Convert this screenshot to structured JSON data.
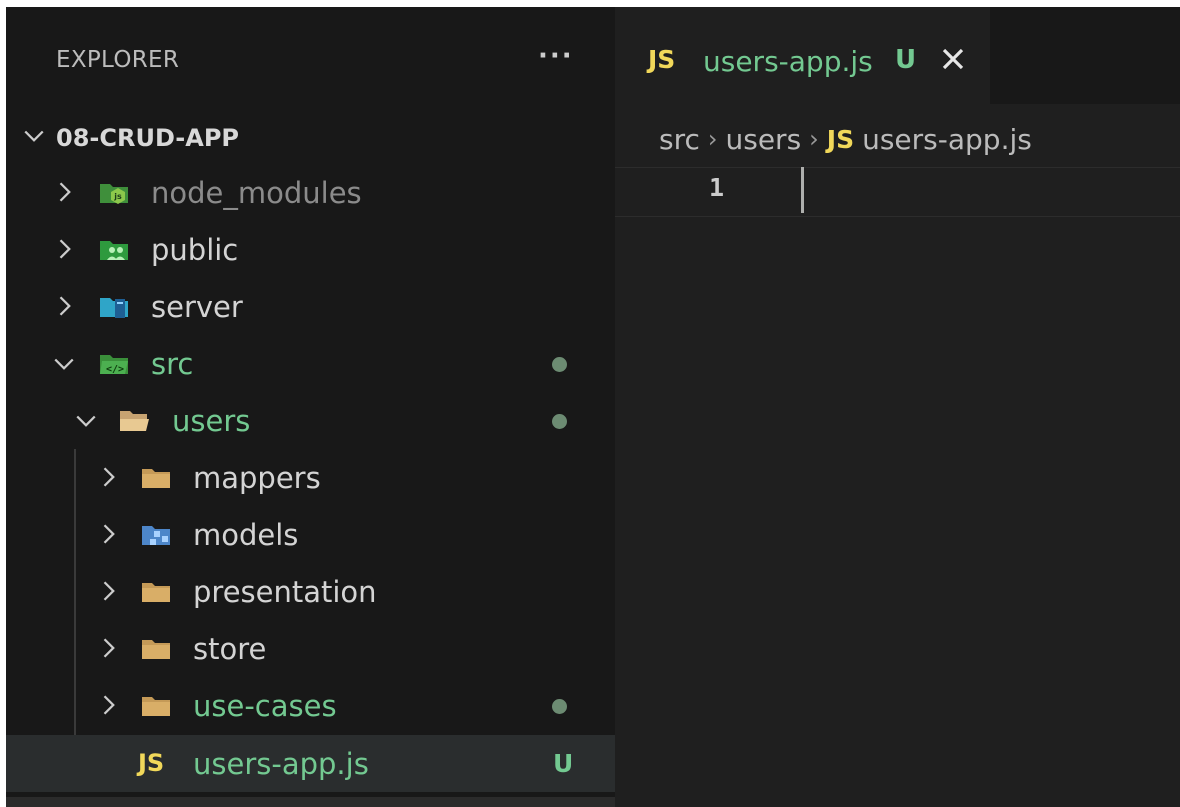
{
  "explorer": {
    "title": "EXPLORER",
    "more_label": "···",
    "root": {
      "label": "08-CRUD-APP",
      "expanded": true
    },
    "items": [
      {
        "label": "node_modules",
        "type": "folder",
        "icon": "nodejs-folder-icon",
        "expanded": false,
        "dim": true
      },
      {
        "label": "public",
        "type": "folder",
        "icon": "public-folder-icon",
        "expanded": false
      },
      {
        "label": "server",
        "type": "folder",
        "icon": "server-folder-icon",
        "expanded": false
      },
      {
        "label": "src",
        "type": "folder",
        "icon": "src-folder-icon",
        "expanded": true,
        "modified": true
      },
      {
        "label": "users",
        "type": "folder",
        "icon": "open-folder-icon",
        "expanded": true,
        "modified": true
      },
      {
        "label": "mappers",
        "type": "folder",
        "icon": "folder-icon",
        "expanded": false
      },
      {
        "label": "models",
        "type": "folder",
        "icon": "models-folder-icon",
        "expanded": false
      },
      {
        "label": "presentation",
        "type": "folder",
        "icon": "folder-icon",
        "expanded": false
      },
      {
        "label": "store",
        "type": "folder",
        "icon": "folder-icon",
        "expanded": false
      },
      {
        "label": "use-cases",
        "type": "folder",
        "icon": "folder-icon",
        "expanded": false,
        "modified": true
      },
      {
        "label": "users-app.js",
        "type": "file",
        "icon": "js-file-icon",
        "js_label": "JS",
        "status": "U",
        "selected": true
      }
    ]
  },
  "editor": {
    "tab": {
      "js_label": "JS",
      "title": "users-app.js",
      "status": "U"
    },
    "breadcrumb": {
      "parts": [
        "src",
        "users"
      ],
      "js_label": "JS",
      "file": "users-app.js"
    },
    "line_number": "1"
  },
  "colors": {
    "untracked_green": "#73c991",
    "js_yellow": "#f1d85a",
    "sidebar_bg": "#181818",
    "editor_bg": "#1f1f1f"
  }
}
